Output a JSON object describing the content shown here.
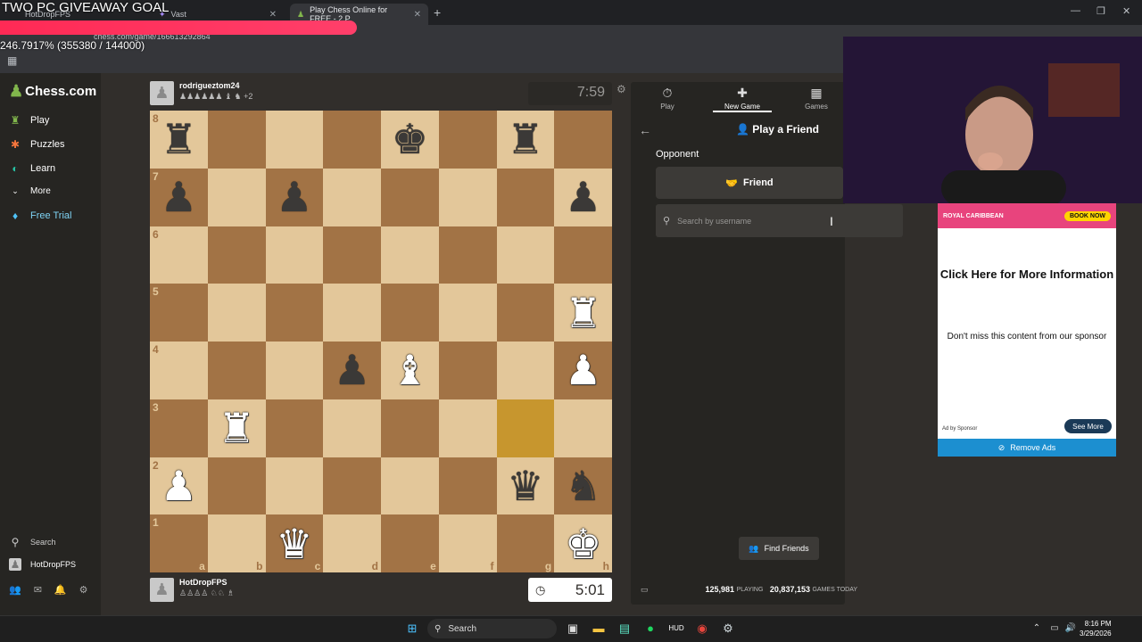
{
  "overlay": {
    "title": "TWO PC GIVEAWAY GOAL",
    "percent": "246.7917% (355380 / 144000)"
  },
  "browser": {
    "tabs": [
      {
        "label": "HotDropFPS"
      },
      {
        "label": "Vast"
      },
      {
        "label": "Play Chess Online for FREE - 2 P"
      }
    ],
    "url": "chess.com/game/166613292864"
  },
  "sidebar": {
    "logo": "Chess.com",
    "items": [
      {
        "label": "Play",
        "icon": "play-icon"
      },
      {
        "label": "Puzzles",
        "icon": "puzzle-icon"
      },
      {
        "label": "Learn",
        "icon": "learn-icon"
      },
      {
        "label": "More",
        "icon": "chevron-down-icon"
      },
      {
        "label": "Free Trial",
        "icon": "diamond-icon"
      }
    ],
    "search": "Search",
    "user": "HotDropFPS"
  },
  "players": {
    "top": {
      "name": "rodriguez­tom24",
      "name_plain": "rodrigueztom24",
      "captured_text": "+2",
      "clock": "7:59"
    },
    "bottom": {
      "name": "HotDropFPS",
      "clock": "5:01"
    }
  },
  "board": {
    "files": [
      "a",
      "b",
      "c",
      "d",
      "e",
      "f",
      "g",
      "h"
    ],
    "ranks": [
      "8",
      "7",
      "6",
      "5",
      "4",
      "3",
      "2",
      "1"
    ],
    "pieces": {
      "a8": "br",
      "e8": "bk",
      "g8": "br",
      "a7": "bp",
      "c7": "bp",
      "h7": "bp",
      "h5": "wr",
      "d4": "bp",
      "e4": "wb",
      "h4": "wp",
      "b3": "wr",
      "a2": "wp",
      "g2": "bq",
      "h2": "bn",
      "c1": "wq",
      "h1": "wk"
    },
    "highlight": [
      "g3"
    ]
  },
  "panel": {
    "tabs": [
      {
        "label": "Play"
      },
      {
        "label": "New Game"
      },
      {
        "label": "Games"
      }
    ],
    "title": "Play a Friend",
    "opponent_label": "Opponent",
    "friend_button": "Friend",
    "search_placeholder": "Search by username",
    "find_friends": "Find Friends",
    "stats": {
      "playing_count": "125,981",
      "playing_label": "PLAYING",
      "games_count": "20,837,153",
      "games_label": "GAMES TODAY"
    }
  },
  "ad": {
    "brand": "ROYAL CARIBBEAN",
    "book": "BOOK NOW",
    "title": "Click Here for More Information",
    "body": "Don't miss this content from our sponsor",
    "by": "Ad by Sponsor",
    "see_more": "See More",
    "remove": "Remove Ads"
  },
  "taskbar": {
    "search": "Search",
    "time": "8:16 PM",
    "date": "3/29/2026"
  },
  "colors": {
    "light_square": "#e3c79a",
    "dark_square": "#a27345",
    "accent_green": "#81b64c",
    "highlight": "#c7962e"
  }
}
